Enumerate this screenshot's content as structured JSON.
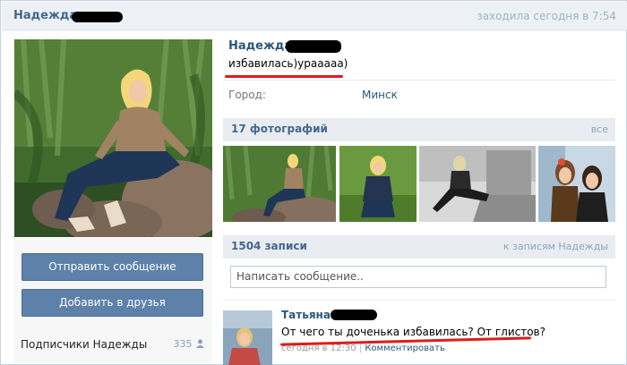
{
  "header": {
    "name": "Надежда",
    "last_seen": "заходила сегодня в 7:54"
  },
  "profile": {
    "name": "Надежда",
    "status": "избавилась)урааааа)",
    "city_label": "Город:",
    "city_value": "Минск"
  },
  "actions": {
    "send_message": "Отправить сообщение",
    "add_friend": "Добавить в друзья"
  },
  "subscribers": {
    "label": "Подписчики Надежды",
    "count": "335"
  },
  "photos": {
    "title": "17 фотографий",
    "all_link": "все"
  },
  "wall": {
    "title": "1504 записи",
    "link": "к записям Надежды",
    "input_placeholder": "Написать сообщение.."
  },
  "post": {
    "author": "Татьяна",
    "text": "От чего ты доченька избавилась? От глистов?",
    "time": "сегодня в 12:30",
    "separator": "|",
    "comments": "Комментировать"
  },
  "colors": {
    "link": "#2b587a",
    "header_bg": "#edf1f5",
    "button": "#5d81a8",
    "highlight": "#e01b1b"
  },
  "icons": [
    "person-icon"
  ]
}
